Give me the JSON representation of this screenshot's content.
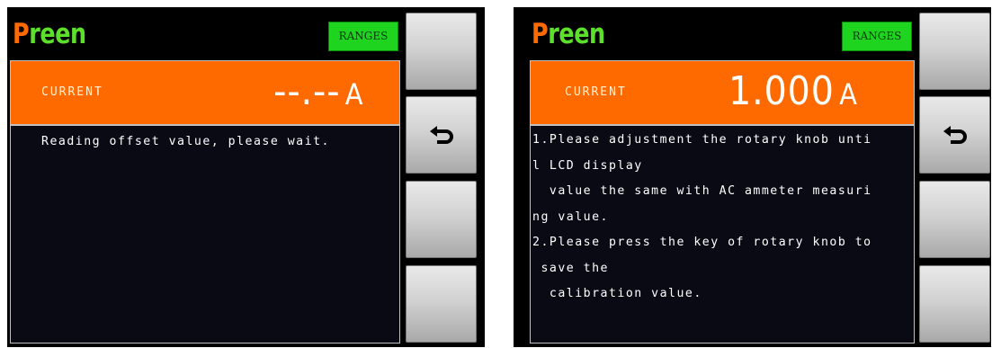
{
  "left_screen": {
    "brand": {
      "first": "P",
      "rest": "reen"
    },
    "ranges_button": "RANGES",
    "reading": {
      "label": "CURRENT",
      "value": "--.--",
      "unit": "A"
    },
    "message_lines": [
      "Reading offset value, please wait."
    ]
  },
  "right_screen": {
    "brand": {
      "first": "P",
      "rest": "reen"
    },
    "ranges_button": "RANGES",
    "reading": {
      "label": "CURRENT",
      "value": "1.000",
      "unit": "A"
    },
    "message_lines": [
      "1.Please adjustment the rotary knob unti",
      "l LCD display",
      "  value the same with AC ammeter measuri",
      "ng value.",
      "2.Please press the key of rotary knob to",
      " save the",
      "  calibration value."
    ]
  },
  "softkeys": {
    "back_icon": "return-arrow-icon",
    "colors": {
      "brand_p": "#ff6a00",
      "brand_reen": "#5de02b",
      "ranges_bg": "#1fd41f",
      "reading_bg": "#ff6a00"
    }
  }
}
